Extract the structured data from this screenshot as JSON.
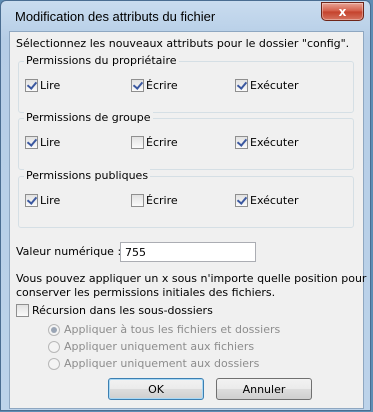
{
  "dialog": {
    "title": "Modification des attributs du fichier",
    "close_label": "x",
    "intro": "Sélectionnez les nouveaux attributs pour le dossier \"config\"."
  },
  "groups": [
    {
      "label": "Permissions du propriétaire",
      "items": [
        {
          "label": "Lire",
          "checked": true
        },
        {
          "label": "Écrire",
          "checked": true
        },
        {
          "label": "Exécuter",
          "checked": true
        }
      ]
    },
    {
      "label": "Permissions de groupe",
      "items": [
        {
          "label": "Lire",
          "checked": true
        },
        {
          "label": "Écrire",
          "checked": false
        },
        {
          "label": "Exécuter",
          "checked": true
        }
      ]
    },
    {
      "label": "Permissions publiques",
      "items": [
        {
          "label": "Lire",
          "checked": true
        },
        {
          "label": "Écrire",
          "checked": false
        },
        {
          "label": "Exécuter",
          "checked": true
        }
      ]
    }
  ],
  "numeric": {
    "label": "Valeur numérique :",
    "value": "755"
  },
  "hint": {
    "line1": "Vous pouvez appliquer un x sous n'importe quelle position pour",
    "line2": "conserver les permissions initiales des fichiers."
  },
  "recursion": {
    "label": "Récursion dans les sous-dossiers",
    "checked": false,
    "options": [
      {
        "label": "Appliquer à tous les fichiers et dossiers",
        "selected": true
      },
      {
        "label": "Appliquer uniquement aux fichiers",
        "selected": false
      },
      {
        "label": "Appliquer uniquement aux dossiers",
        "selected": false
      }
    ]
  },
  "buttons": {
    "ok": "OK",
    "cancel": "Annuler"
  }
}
